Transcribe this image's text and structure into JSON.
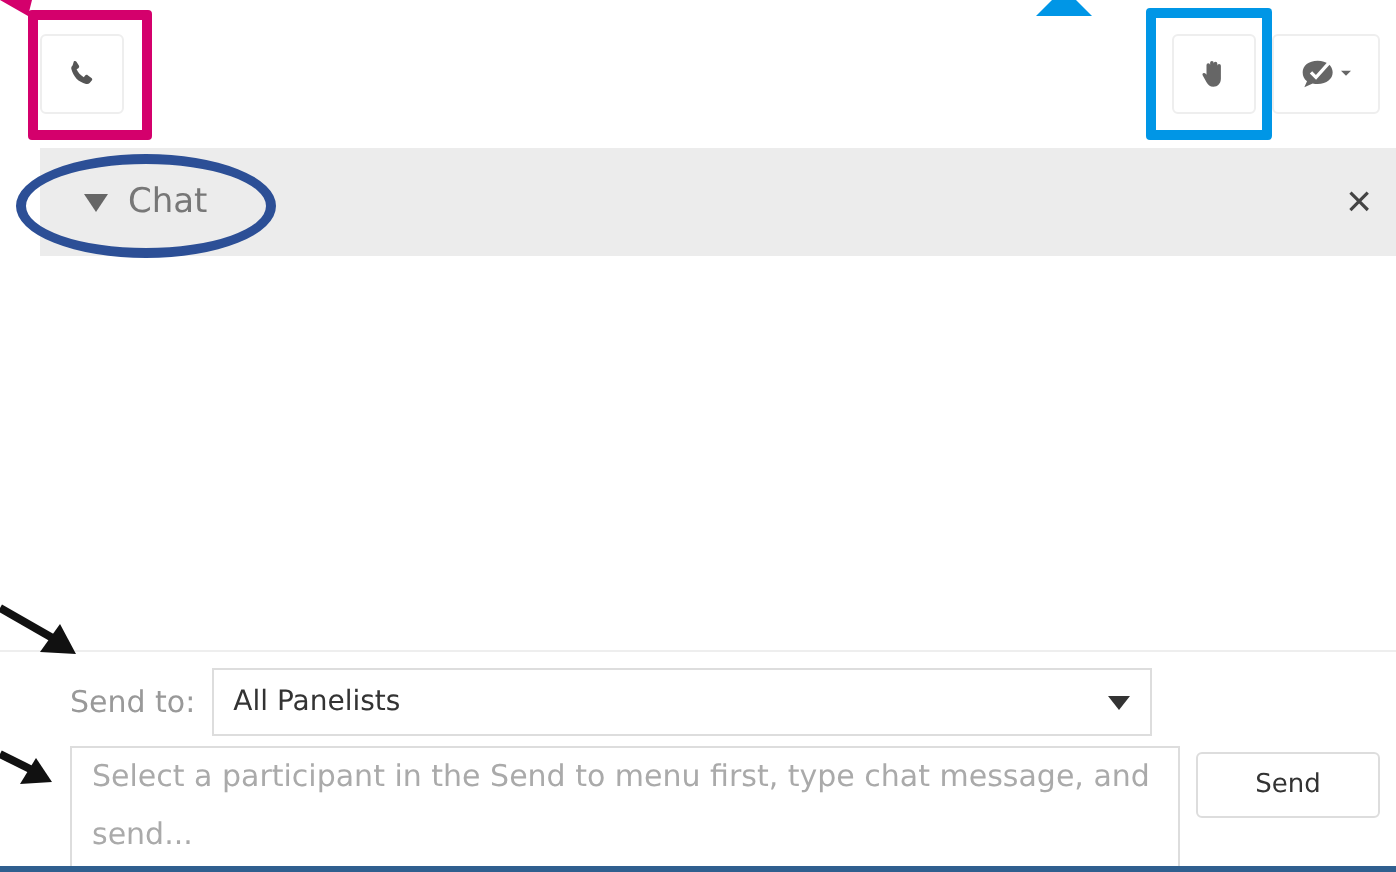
{
  "chat_panel": {
    "title": "Chat",
    "expanded": true,
    "close": "×"
  },
  "send_to": {
    "label": "Send to:",
    "value": "All Panelists"
  },
  "message": {
    "placeholder": "Select a participant in the Send to menu first, type chat message, and send..."
  },
  "send_button": "Send"
}
